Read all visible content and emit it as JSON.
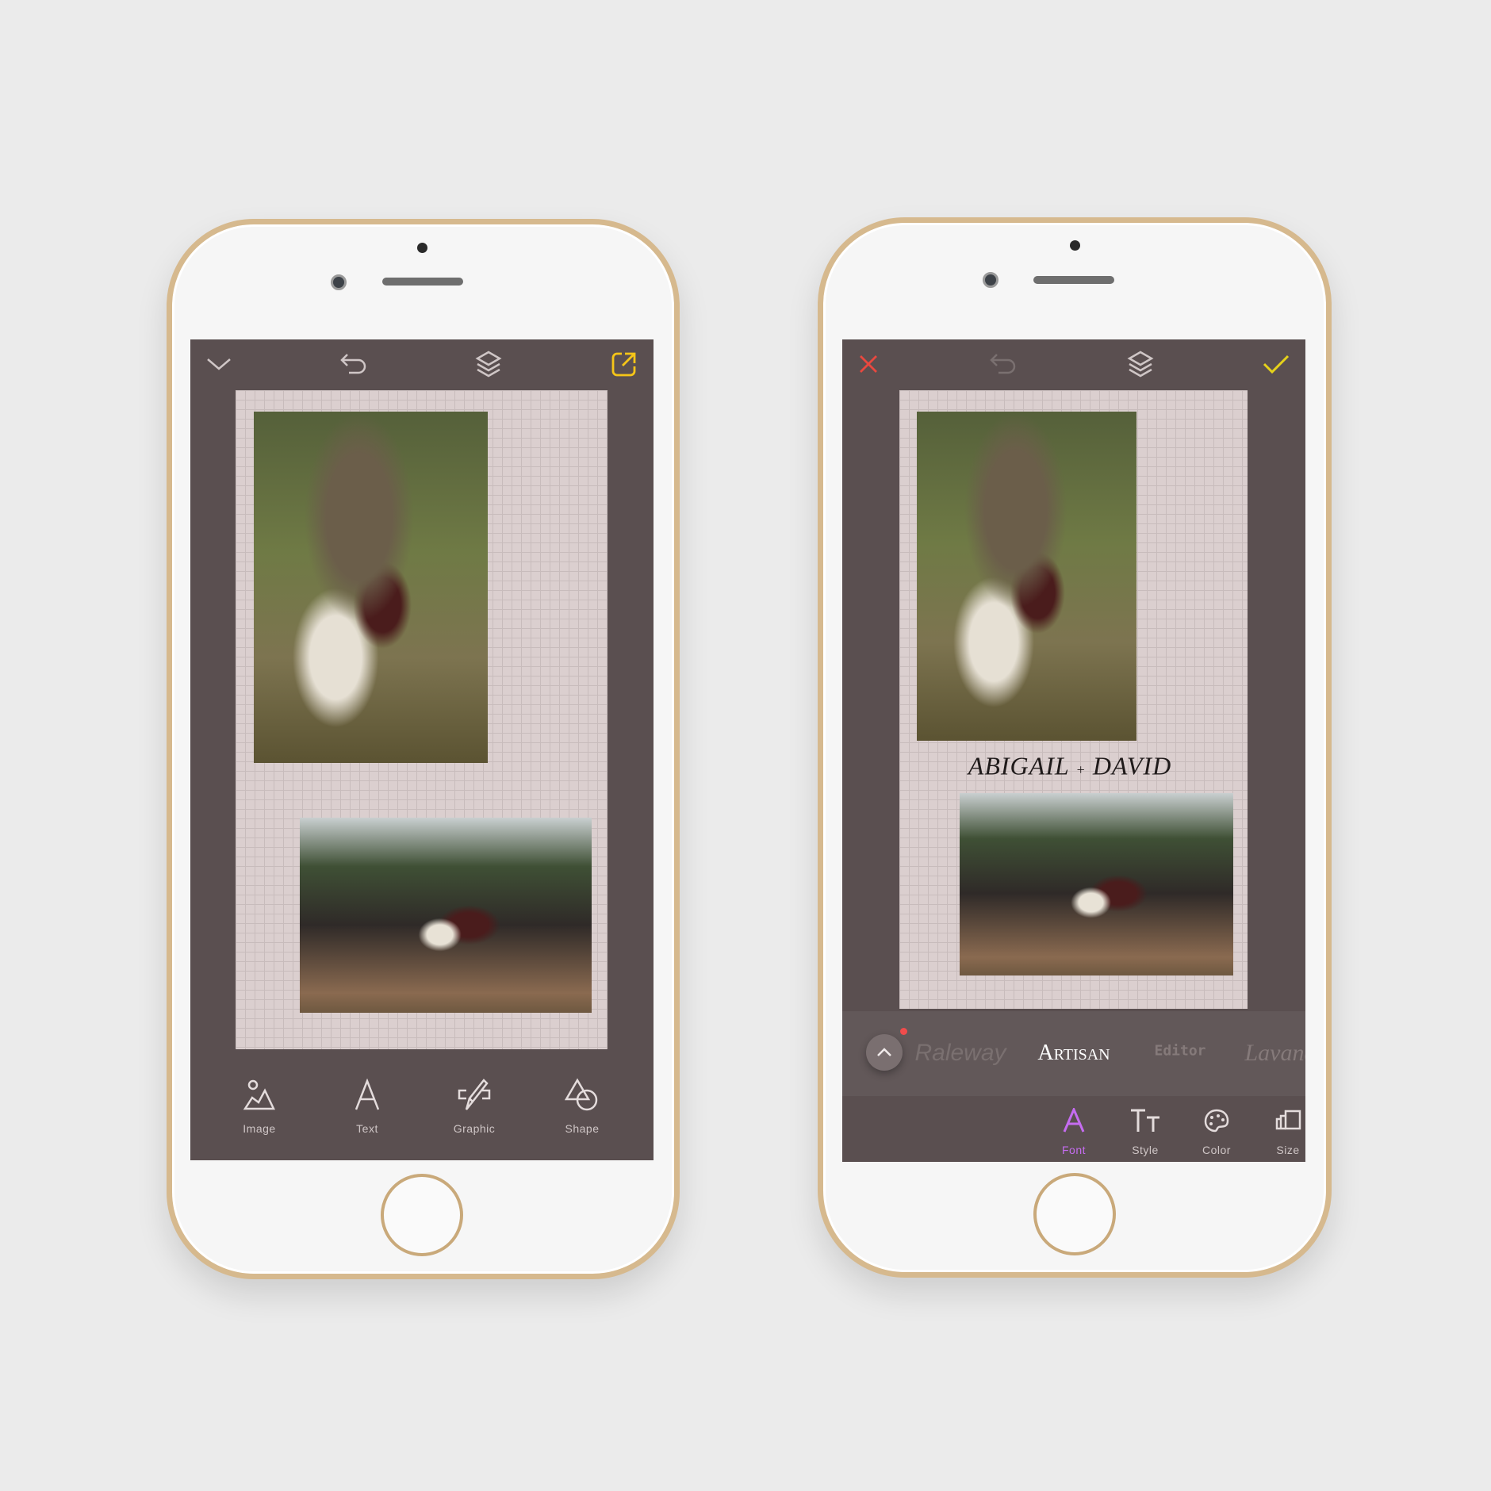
{
  "left_phone": {
    "topbar": {
      "icons": [
        "chevron-down-icon",
        "undo-icon",
        "layers-icon",
        "share-icon"
      ],
      "share_color": "#f5c518"
    },
    "toolbar": [
      {
        "label": "Image",
        "icon": "image-icon"
      },
      {
        "label": "Text",
        "icon": "text-icon"
      },
      {
        "label": "Graphic",
        "icon": "graphic-icon"
      },
      {
        "label": "Shape",
        "icon": "shape-icon"
      }
    ]
  },
  "right_phone": {
    "topbar": {
      "icons": [
        "close-icon",
        "undo-icon",
        "layers-icon",
        "check-icon"
      ],
      "close_color": "#e8483f",
      "check_color": "#e6d21a"
    },
    "title_text": {
      "left": "ABIGAIL",
      "plus": "+",
      "right": "DAVID"
    },
    "fonts": [
      "Raleway",
      "Artisan",
      "Editor",
      "Lavanda"
    ],
    "selected_font": "Artisan",
    "tabs": [
      {
        "label": "Font",
        "icon": "font-icon",
        "active": true
      },
      {
        "label": "Style",
        "icon": "style-icon"
      },
      {
        "label": "Color",
        "icon": "palette-icon"
      },
      {
        "label": "Size",
        "icon": "size-icon"
      }
    ],
    "accent": "#c56cf0"
  }
}
